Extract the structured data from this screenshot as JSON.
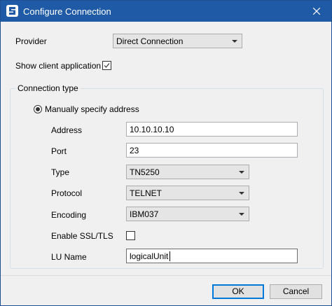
{
  "window": {
    "title": "Configure Connection",
    "icon": "app-logo-icon",
    "close_icon": "close-icon"
  },
  "provider": {
    "label": "Provider",
    "selected": "Direct Connection"
  },
  "show_client": {
    "label": "Show client application",
    "checked": true
  },
  "connection_type": {
    "legend": "Connection type",
    "radio_label": "Manually specify address",
    "radio_selected": true,
    "fields": {
      "address": {
        "label": "Address",
        "value": "10.10.10.10"
      },
      "port": {
        "label": "Port",
        "value": "23"
      },
      "type": {
        "label": "Type",
        "selected": "TN5250"
      },
      "protocol": {
        "label": "Protocol",
        "selected": "TELNET"
      },
      "encoding": {
        "label": "Encoding",
        "selected": "IBM037"
      },
      "ssl": {
        "label": "Enable SSL/TLS",
        "checked": false
      },
      "lu_name": {
        "label": "LU Name",
        "value": "logicalUnit"
      }
    }
  },
  "buttons": {
    "ok": "OK",
    "cancel": "Cancel"
  },
  "colors": {
    "titlebar": "#1e5aa6",
    "dialog_bg": "#f0f0f0",
    "default_button_border": "#0078d7"
  }
}
